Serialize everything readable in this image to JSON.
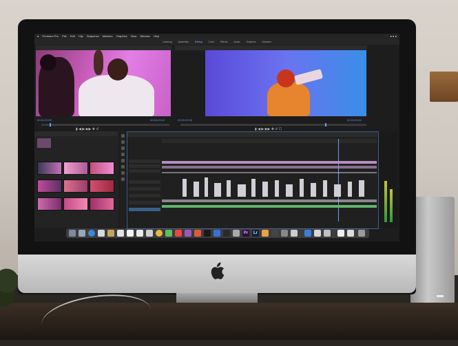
{
  "menubar": {
    "app_name": "Premiere Pro",
    "items": [
      "File",
      "Edit",
      "Clip",
      "Sequence",
      "Markers",
      "Graphics",
      "View",
      "Window",
      "Help"
    ]
  },
  "workspaces": {
    "items": [
      "Learning",
      "Assembly",
      "Editing",
      "Color",
      "Effects",
      "Audio",
      "Graphics",
      "Libraries"
    ],
    "active": "Editing"
  },
  "source_monitor": {
    "timecode_left": "00:00:00:00",
    "timecode_right": "00:00:03:22"
  },
  "program_monitor": {
    "timecode_left": "00:00:00:00",
    "timecode_right": "00:00:03:22"
  },
  "dock": {
    "pr_label": "Pr",
    "lr_label": "Lr"
  },
  "colors": {
    "accent": "#5f96ff",
    "video_clip": "#b58fc0",
    "audio_clip": "#cfcfd6",
    "green_clip": "#5fb66a",
    "source_bg": "#c55bb6",
    "program_bg": "#6a73f0"
  }
}
